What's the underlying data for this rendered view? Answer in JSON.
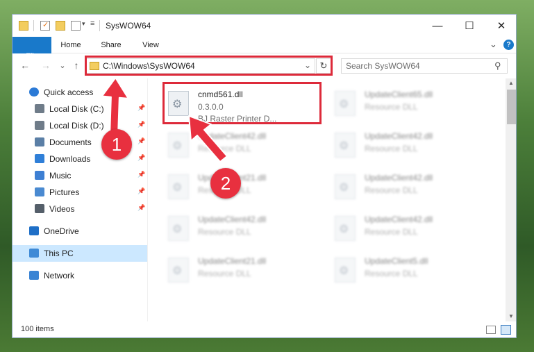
{
  "window": {
    "title": "SysWOW64",
    "controls": {
      "minimize": "—",
      "maximize": "☐",
      "close": "✕"
    }
  },
  "ribbon": {
    "tabs": [
      "File",
      "Home",
      "Share",
      "View"
    ],
    "expand": "⌄",
    "help": "?"
  },
  "nav": {
    "back": "←",
    "forward": "→",
    "recent": "⌄",
    "up": "↑",
    "address": "C:\\Windows\\SysWOW64",
    "dropdown": "⌄",
    "refresh": "↻",
    "search_placeholder": "Search SysWOW64"
  },
  "sidebar": {
    "items": [
      {
        "label": "Quick access",
        "icon": "star-icon"
      },
      {
        "label": "Local Disk (C:)",
        "icon": "drive-icon",
        "pinned": true
      },
      {
        "label": "Local Disk (D:)",
        "icon": "drive-icon",
        "pinned": true
      },
      {
        "label": "Documents",
        "icon": "documents-icon",
        "pinned": true
      },
      {
        "label": "Downloads",
        "icon": "download-icon",
        "pinned": true
      },
      {
        "label": "Music",
        "icon": "music-icon",
        "pinned": true
      },
      {
        "label": "Pictures",
        "icon": "pictures-icon",
        "pinned": true
      },
      {
        "label": "Videos",
        "icon": "videos-icon",
        "pinned": true
      },
      {
        "label": "OneDrive",
        "icon": "cloud-icon"
      },
      {
        "label": "This PC",
        "icon": "computer-icon",
        "selected": true
      },
      {
        "label": "Network",
        "icon": "network-icon"
      }
    ]
  },
  "files": [
    {
      "name": "cnmd561.dll",
      "version": "0.3.0.0",
      "description": "BJ Raster Printer D...",
      "focus": true
    },
    {
      "name": "UpdateClient65.dll",
      "description": "Resource DLL"
    },
    {
      "name": "UpdateClient42.dll",
      "description": "Resource DLL"
    },
    {
      "name": "UpdateClient42.dll",
      "description": "Resource DLL"
    },
    {
      "name": "UpdateClient21.dll",
      "description": "Resource DLL"
    },
    {
      "name": "UpdateClient42.dll",
      "description": "Resource DLL"
    },
    {
      "name": "UpdateClient42.dll",
      "description": "Resource DLL"
    },
    {
      "name": "UpdateClient42.dll",
      "description": "Resource DLL"
    },
    {
      "name": "UpdateClient21.dll",
      "description": "Resource DLL"
    },
    {
      "name": "UpdateClient5.dll",
      "description": "Resource DLL"
    }
  ],
  "status": {
    "items": "100 items"
  },
  "annotations": {
    "marker1": "1",
    "marker2": "2",
    "color": "#e8303f"
  },
  "colors": {
    "accent": "#1979ca",
    "selection": "#cce8ff",
    "highlight": "#dd2a3a"
  }
}
